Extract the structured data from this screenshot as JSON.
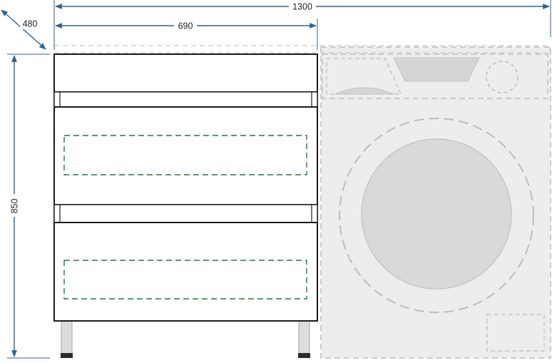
{
  "dimensions": {
    "total_width": "1300",
    "cabinet_width": "690",
    "depth": "480",
    "height": "850"
  },
  "colors": {
    "dimension_line": "#2d6490",
    "cabinet_outline": "#1a1a1a",
    "drawer_handle_outline": "#1f7a3f",
    "machine_fill": "#ededed",
    "machine_outline": "#bdbdbd",
    "machine_door": "#d9d9d9"
  }
}
